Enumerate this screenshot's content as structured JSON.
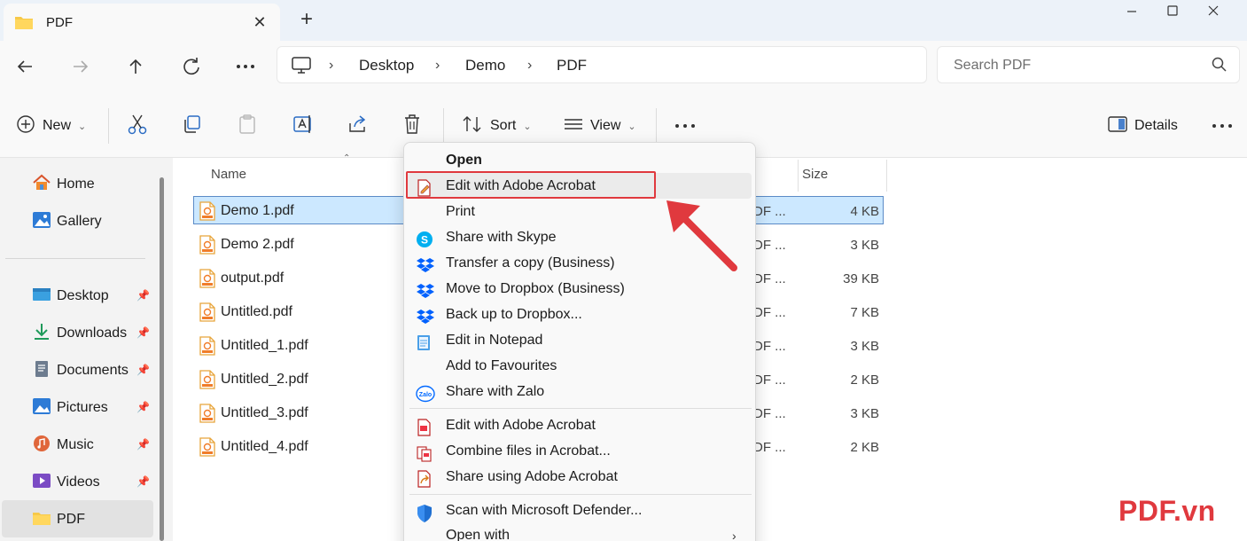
{
  "window": {
    "tab_title": "PDF"
  },
  "address": {
    "crumbs": [
      "Desktop",
      "Demo",
      "PDF"
    ]
  },
  "search": {
    "placeholder": "Search PDF"
  },
  "toolbar": {
    "new_label": "New",
    "sort_label": "Sort",
    "view_label": "View",
    "details_label": "Details"
  },
  "sidebar": {
    "top": [
      "Home",
      "Gallery"
    ],
    "pinned": [
      "Desktop",
      "Downloads",
      "Documents",
      "Pictures",
      "Music",
      "Videos",
      "PDF"
    ]
  },
  "columns": {
    "name": "Name",
    "size": "Size"
  },
  "files": [
    {
      "name": "Demo 1.pdf",
      "type": "DF ...",
      "size": "4 KB"
    },
    {
      "name": "Demo 2.pdf",
      "type": "DF ...",
      "size": "3 KB"
    },
    {
      "name": "output.pdf",
      "type": "DF ...",
      "size": "39 KB"
    },
    {
      "name": "Untitled.pdf",
      "type": "DF ...",
      "size": "7 KB"
    },
    {
      "name": "Untitled_1.pdf",
      "type": "DF ...",
      "size": "3 KB"
    },
    {
      "name": "Untitled_2.pdf",
      "type": "DF ...",
      "size": "2 KB"
    },
    {
      "name": "Untitled_3.pdf",
      "type": "DF ...",
      "size": "3 KB"
    },
    {
      "name": "Untitled_4.pdf",
      "type": "DF ...",
      "size": "2 KB"
    }
  ],
  "context_menu": {
    "open": "Open",
    "items": [
      "Edit with Adobe Acrobat",
      "Print",
      "Share with Skype",
      "Transfer a copy (Business)",
      "Move to Dropbox (Business)",
      "Back up to Dropbox...",
      "Edit in Notepad",
      "Add to Favourites",
      "Share with Zalo"
    ],
    "acrobat_items": [
      "Edit with Adobe Acrobat",
      "Combine files in Acrobat...",
      "Share using Adobe Acrobat"
    ],
    "bottom_items": [
      "Scan with Microsoft Defender...",
      "Open with"
    ]
  },
  "watermark": "PDF.vn",
  "colors": {
    "highlight": "#e0393e",
    "selection": "#cce8ff",
    "accent": "#0067c0"
  }
}
